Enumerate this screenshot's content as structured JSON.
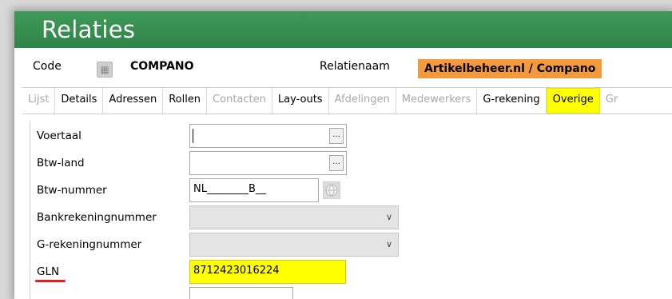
{
  "window": {
    "title": "Relaties"
  },
  "header": {
    "code_label": "Code",
    "code_value": "COMPANO",
    "relname_label": "Relatienaam",
    "relname_value": "Artikelbeheer.nl / Compano",
    "relname_color": "#f59a3c"
  },
  "tabs": [
    {
      "label": "Lijst",
      "state": "disabled"
    },
    {
      "label": "Details",
      "state": "normal"
    },
    {
      "label": "Adressen",
      "state": "normal"
    },
    {
      "label": "Rollen",
      "state": "normal"
    },
    {
      "label": "Contacten",
      "state": "disabled"
    },
    {
      "label": "Lay-outs",
      "state": "normal"
    },
    {
      "label": "Afdelingen",
      "state": "disabled"
    },
    {
      "label": "Medewerkers",
      "state": "disabled"
    },
    {
      "label": "G-rekening",
      "state": "normal"
    },
    {
      "label": "Overige",
      "state": "active"
    },
    {
      "label": "Gr",
      "state": "disabled"
    }
  ],
  "form": {
    "voertaal": {
      "label": "Voertaal",
      "value": ""
    },
    "btw_land": {
      "label": "Btw-land",
      "value": ""
    },
    "btw_nummer": {
      "label": "Btw-nummer",
      "value": "NL________B__"
    },
    "bankrekeningnummer": {
      "label": "Bankrekeningnummer",
      "value": ""
    },
    "g_rekeningnummer": {
      "label": "G-rekeningnummer",
      "value": ""
    },
    "gln": {
      "label": "GLN",
      "value": "8712423016224",
      "highlight": "#ffff00"
    }
  },
  "icons": {
    "ellipsis": "…",
    "chevron": "∨",
    "globe": "globe-icon"
  },
  "colors": {
    "titlebar": "#2f8447",
    "active_tab": "#ffff00",
    "gln_underline": "#e02020"
  }
}
